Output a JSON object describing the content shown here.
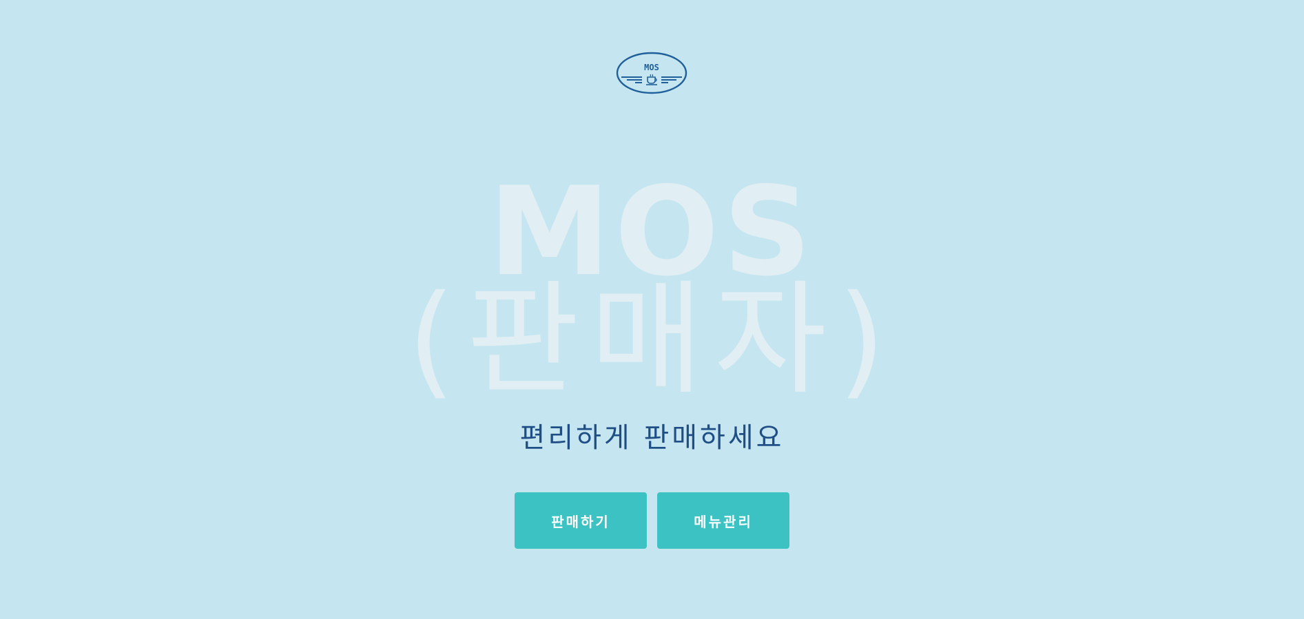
{
  "logo": {
    "text": "MOS",
    "icon": "coffee-cup-icon"
  },
  "hero": {
    "line1": "MOS",
    "line2": "(판매자)"
  },
  "subtitle": "편리하게 판매하세요",
  "buttons": {
    "sell_label": "판매하기",
    "menu_label": "메뉴관리"
  },
  "colors": {
    "background": "#c5e6f0",
    "hero_text": "#e1eef3",
    "subtitle_text": "#1f4e86",
    "logo": "#1f5f9a",
    "button": "#3cc2c2",
    "button_text": "#ffffff"
  }
}
